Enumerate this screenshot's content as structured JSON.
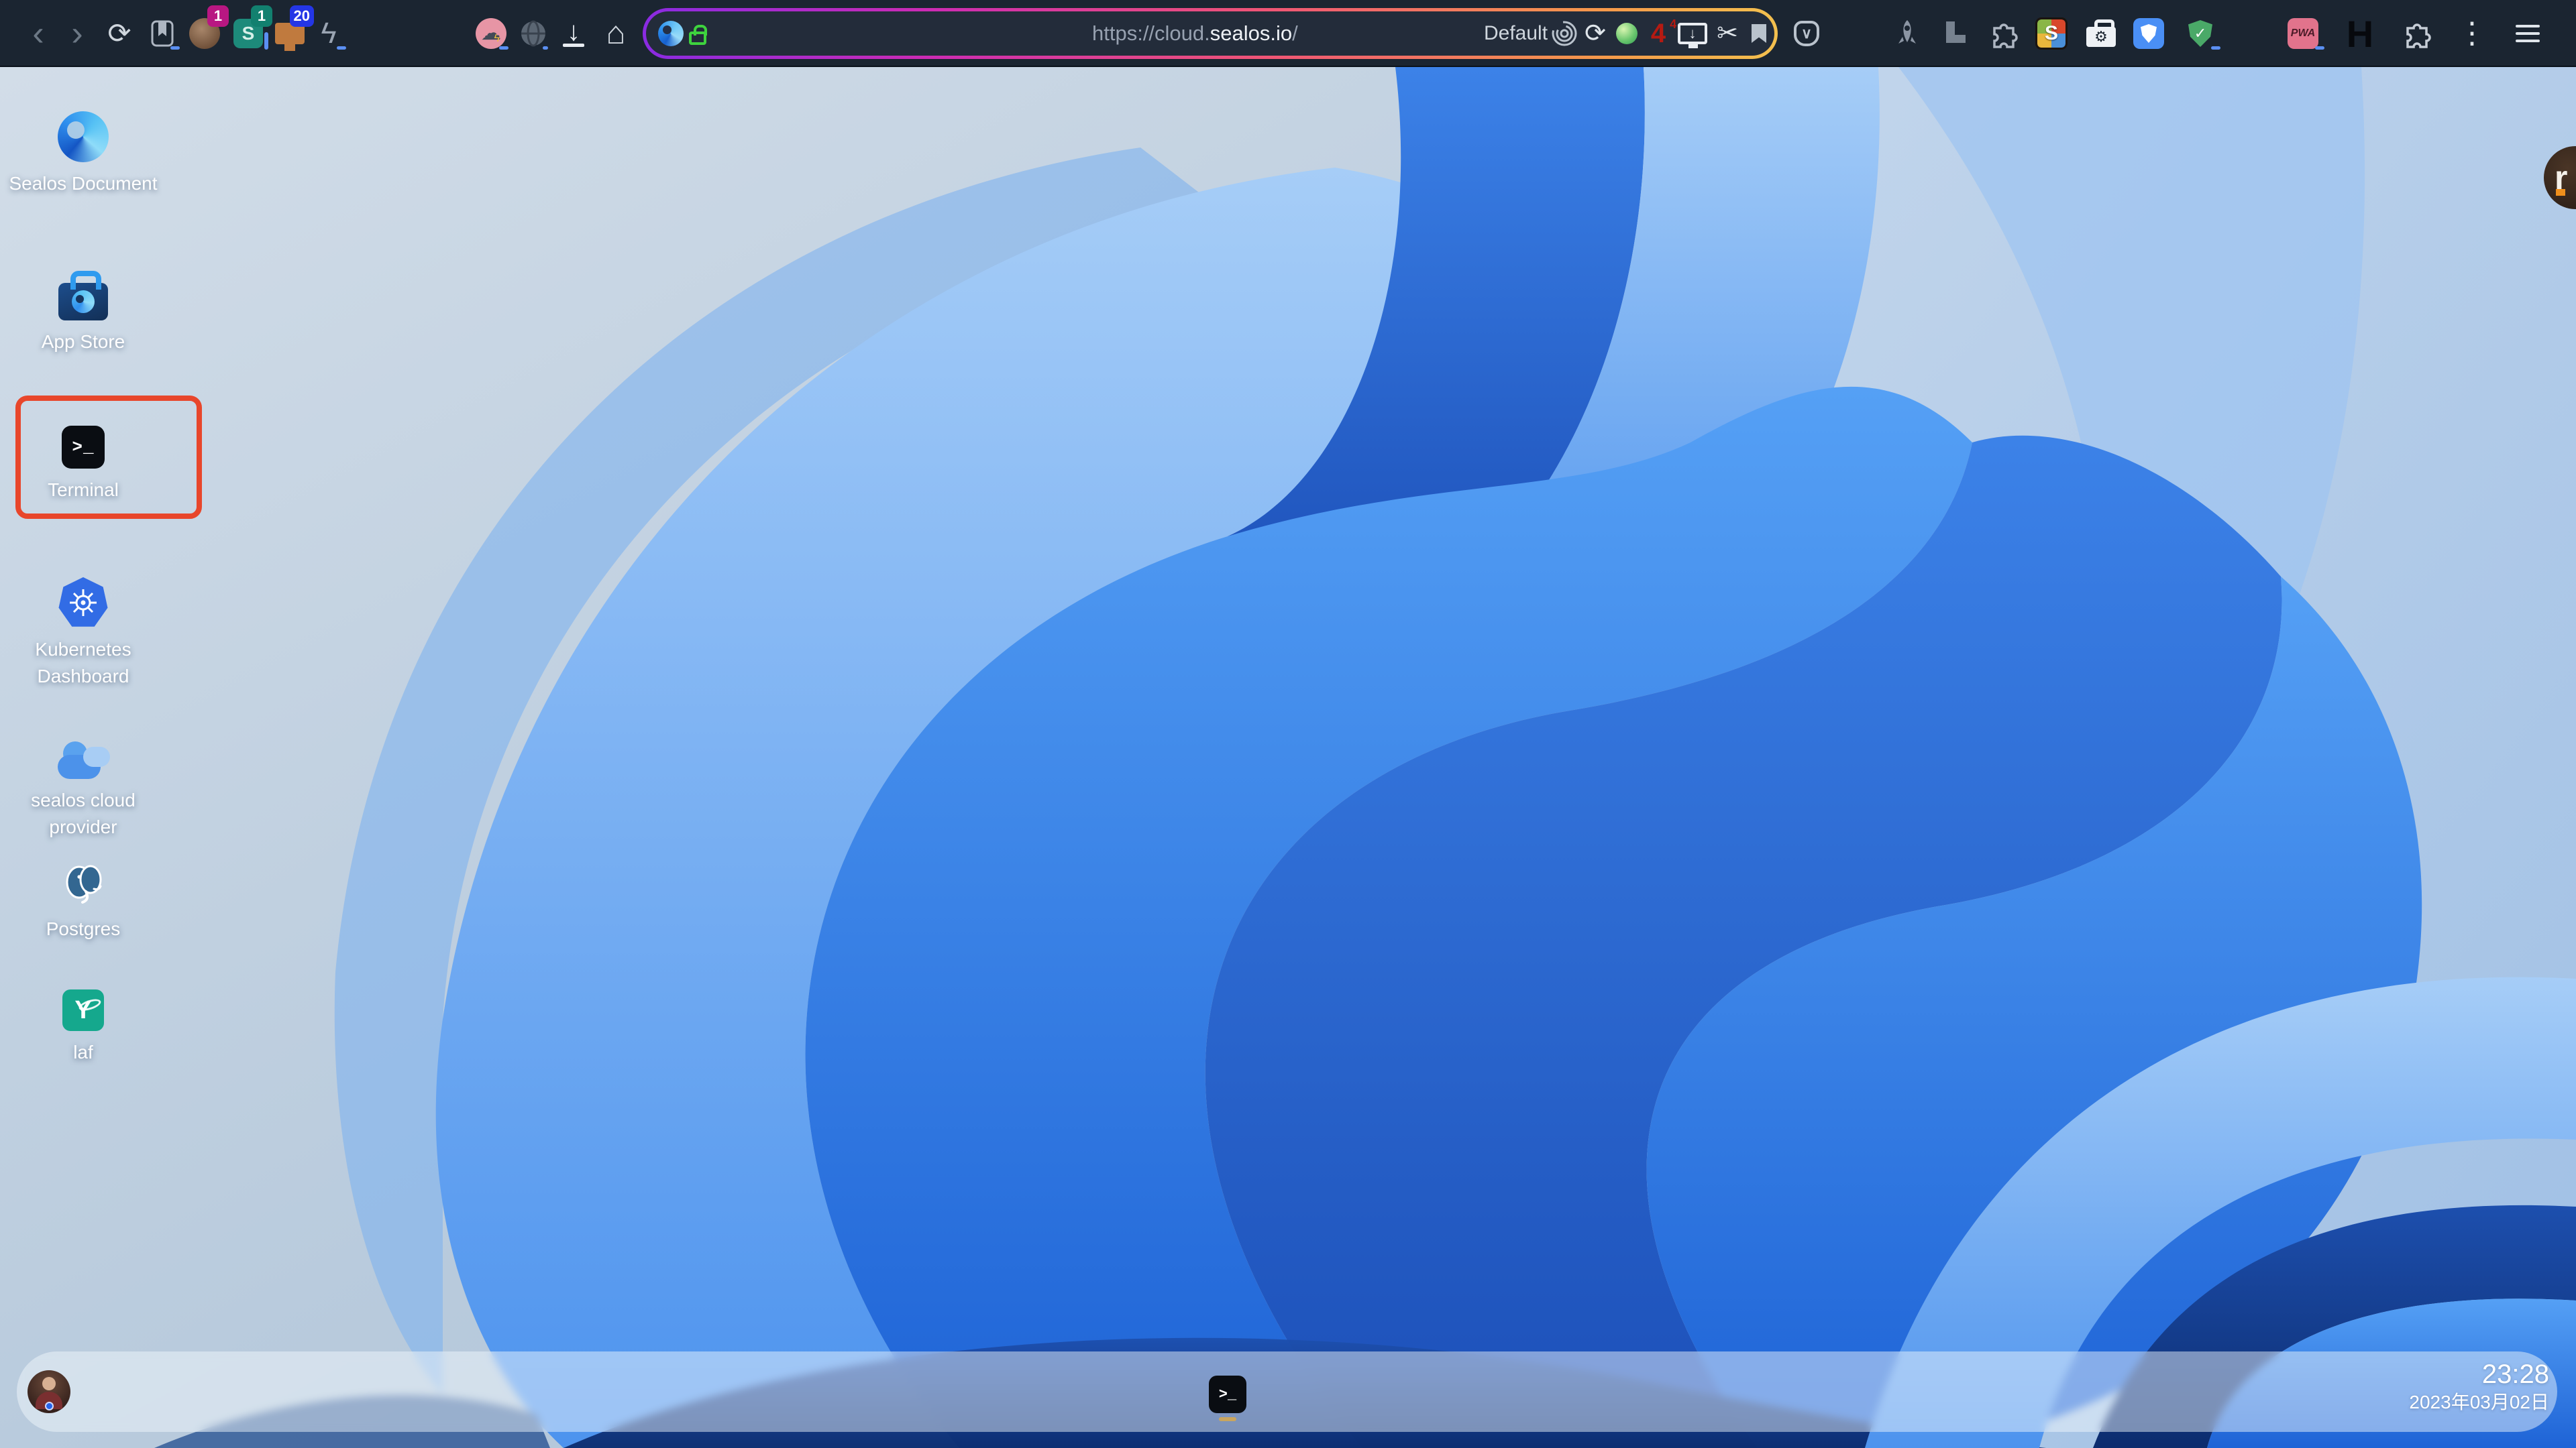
{
  "browser": {
    "toolbar": {
      "ext_badge_1": "1",
      "ext_badge_2": "1",
      "ext_badge_3": "20",
      "fourchan_count": "4",
      "fourchan_sup": "4",
      "teal_letter": "S",
      "stylus_letter": "S",
      "pwa_label": "PWA",
      "h_label": "H"
    },
    "urlbar": {
      "scheme_prefix": "https://cloud.",
      "domain": "sealos.io",
      "path": "/",
      "container_label": "Default"
    }
  },
  "icons": {
    "back": "‹",
    "forward": "›",
    "reload": "⟳",
    "star": "★",
    "lightning": "ϟ",
    "storm_cloud": "☁",
    "storm_bolt": "ϟ",
    "download_arrow": "↓",
    "home": "⌂",
    "url_reload": "⟳",
    "monitor_arrow": "↓",
    "scissors": "✂",
    "pocket_chevron": "∨",
    "gear": "⚙",
    "check": "✓",
    "kebab": "⋮"
  },
  "desktop": {
    "icons": [
      {
        "label": "Sealos Document"
      },
      {
        "label": "App Store"
      },
      {
        "label": "Terminal",
        "glyph": ">_"
      },
      {
        "label": "Kubernetes Dashboard"
      },
      {
        "label": "sealos cloud provider"
      },
      {
        "label": "Postgres"
      },
      {
        "label": "laf",
        "glyph": "Y"
      }
    ],
    "annotation_color": "#e8462b"
  },
  "dock": {
    "terminal_glyph": ">_"
  },
  "taskbar": {
    "time": "23:28",
    "date": "2023年03月02日"
  },
  "edge_button": {
    "label": "r"
  },
  "colors": {
    "toolbar_bg": "#1b2531",
    "annotation_box": "#e8462b",
    "urlbar_gradient": [
      "#8a2be2",
      "#cc2bb4",
      "#f05575",
      "#f59a4a",
      "#f3c04e"
    ],
    "lock": "#3ed33e",
    "kubernetes_blue": "#326ce5",
    "laf_teal": "#15a88d",
    "dock_indicator": "#c9a55f",
    "taskbar_bg": "rgba(243,248,252,0.48)"
  }
}
